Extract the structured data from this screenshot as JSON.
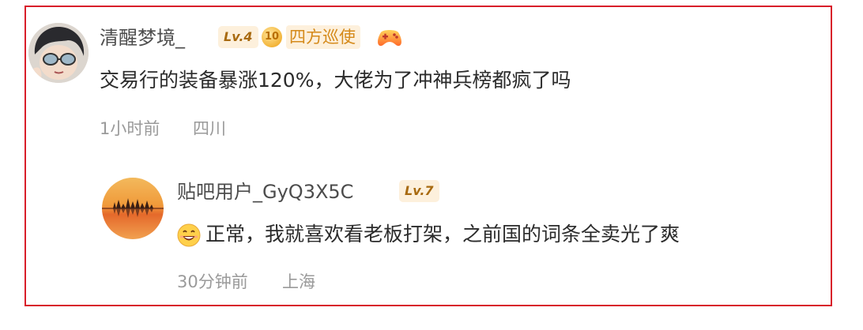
{
  "comment": {
    "username": "清醒梦境_",
    "level": "Lv.4",
    "fan_badge_level": "10",
    "fan_badge_title": "四方巡使",
    "badge_icon": "gamepad-icon",
    "content": "交易行的装备暴涨120%，大佬为了冲神兵榜都疯了吗",
    "time": "1小时前",
    "location": "四川"
  },
  "reply": {
    "username": "贴吧用户_GyQ3X5C",
    "level": "Lv.7",
    "emoji": "grinning-face-emoji",
    "content": "正常，我就喜欢看老板打架，之前国的词条全卖光了爽",
    "time": "30分钟前",
    "location": "上海"
  },
  "colors": {
    "frame_border": "#d81e2a",
    "level_badge_bg": "#fdf0dc",
    "level_badge_text": "#a86a10",
    "meta_text": "#9a9a9a"
  }
}
